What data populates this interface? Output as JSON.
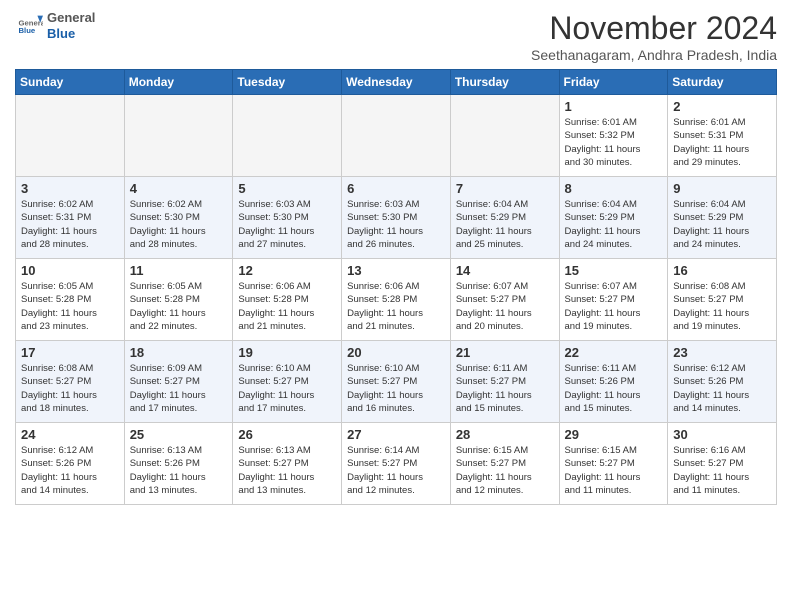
{
  "header": {
    "logo_general": "General",
    "logo_blue": "Blue",
    "month": "November 2024",
    "location": "Seethanagaram, Andhra Pradesh, India"
  },
  "weekdays": [
    "Sunday",
    "Monday",
    "Tuesday",
    "Wednesday",
    "Thursday",
    "Friday",
    "Saturday"
  ],
  "weeks": [
    [
      {
        "day": "",
        "info": ""
      },
      {
        "day": "",
        "info": ""
      },
      {
        "day": "",
        "info": ""
      },
      {
        "day": "",
        "info": ""
      },
      {
        "day": "",
        "info": ""
      },
      {
        "day": "1",
        "info": "Sunrise: 6:01 AM\nSunset: 5:32 PM\nDaylight: 11 hours\nand 30 minutes."
      },
      {
        "day": "2",
        "info": "Sunrise: 6:01 AM\nSunset: 5:31 PM\nDaylight: 11 hours\nand 29 minutes."
      }
    ],
    [
      {
        "day": "3",
        "info": "Sunrise: 6:02 AM\nSunset: 5:31 PM\nDaylight: 11 hours\nand 28 minutes."
      },
      {
        "day": "4",
        "info": "Sunrise: 6:02 AM\nSunset: 5:30 PM\nDaylight: 11 hours\nand 28 minutes."
      },
      {
        "day": "5",
        "info": "Sunrise: 6:03 AM\nSunset: 5:30 PM\nDaylight: 11 hours\nand 27 minutes."
      },
      {
        "day": "6",
        "info": "Sunrise: 6:03 AM\nSunset: 5:30 PM\nDaylight: 11 hours\nand 26 minutes."
      },
      {
        "day": "7",
        "info": "Sunrise: 6:04 AM\nSunset: 5:29 PM\nDaylight: 11 hours\nand 25 minutes."
      },
      {
        "day": "8",
        "info": "Sunrise: 6:04 AM\nSunset: 5:29 PM\nDaylight: 11 hours\nand 24 minutes."
      },
      {
        "day": "9",
        "info": "Sunrise: 6:04 AM\nSunset: 5:29 PM\nDaylight: 11 hours\nand 24 minutes."
      }
    ],
    [
      {
        "day": "10",
        "info": "Sunrise: 6:05 AM\nSunset: 5:28 PM\nDaylight: 11 hours\nand 23 minutes."
      },
      {
        "day": "11",
        "info": "Sunrise: 6:05 AM\nSunset: 5:28 PM\nDaylight: 11 hours\nand 22 minutes."
      },
      {
        "day": "12",
        "info": "Sunrise: 6:06 AM\nSunset: 5:28 PM\nDaylight: 11 hours\nand 21 minutes."
      },
      {
        "day": "13",
        "info": "Sunrise: 6:06 AM\nSunset: 5:28 PM\nDaylight: 11 hours\nand 21 minutes."
      },
      {
        "day": "14",
        "info": "Sunrise: 6:07 AM\nSunset: 5:27 PM\nDaylight: 11 hours\nand 20 minutes."
      },
      {
        "day": "15",
        "info": "Sunrise: 6:07 AM\nSunset: 5:27 PM\nDaylight: 11 hours\nand 19 minutes."
      },
      {
        "day": "16",
        "info": "Sunrise: 6:08 AM\nSunset: 5:27 PM\nDaylight: 11 hours\nand 19 minutes."
      }
    ],
    [
      {
        "day": "17",
        "info": "Sunrise: 6:08 AM\nSunset: 5:27 PM\nDaylight: 11 hours\nand 18 minutes."
      },
      {
        "day": "18",
        "info": "Sunrise: 6:09 AM\nSunset: 5:27 PM\nDaylight: 11 hours\nand 17 minutes."
      },
      {
        "day": "19",
        "info": "Sunrise: 6:10 AM\nSunset: 5:27 PM\nDaylight: 11 hours\nand 17 minutes."
      },
      {
        "day": "20",
        "info": "Sunrise: 6:10 AM\nSunset: 5:27 PM\nDaylight: 11 hours\nand 16 minutes."
      },
      {
        "day": "21",
        "info": "Sunrise: 6:11 AM\nSunset: 5:27 PM\nDaylight: 11 hours\nand 15 minutes."
      },
      {
        "day": "22",
        "info": "Sunrise: 6:11 AM\nSunset: 5:26 PM\nDaylight: 11 hours\nand 15 minutes."
      },
      {
        "day": "23",
        "info": "Sunrise: 6:12 AM\nSunset: 5:26 PM\nDaylight: 11 hours\nand 14 minutes."
      }
    ],
    [
      {
        "day": "24",
        "info": "Sunrise: 6:12 AM\nSunset: 5:26 PM\nDaylight: 11 hours\nand 14 minutes."
      },
      {
        "day": "25",
        "info": "Sunrise: 6:13 AM\nSunset: 5:26 PM\nDaylight: 11 hours\nand 13 minutes."
      },
      {
        "day": "26",
        "info": "Sunrise: 6:13 AM\nSunset: 5:27 PM\nDaylight: 11 hours\nand 13 minutes."
      },
      {
        "day": "27",
        "info": "Sunrise: 6:14 AM\nSunset: 5:27 PM\nDaylight: 11 hours\nand 12 minutes."
      },
      {
        "day": "28",
        "info": "Sunrise: 6:15 AM\nSunset: 5:27 PM\nDaylight: 11 hours\nand 12 minutes."
      },
      {
        "day": "29",
        "info": "Sunrise: 6:15 AM\nSunset: 5:27 PM\nDaylight: 11 hours\nand 11 minutes."
      },
      {
        "day": "30",
        "info": "Sunrise: 6:16 AM\nSunset: 5:27 PM\nDaylight: 11 hours\nand 11 minutes."
      }
    ]
  ]
}
